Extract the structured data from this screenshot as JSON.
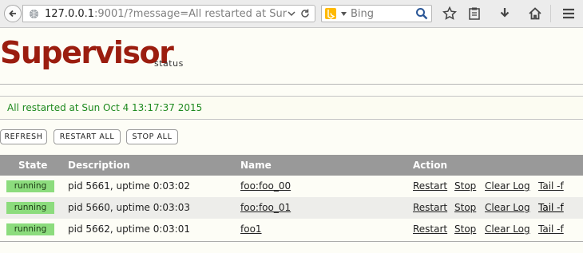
{
  "browser": {
    "url_host": "127.0.0.1",
    "url_rest": ":9001/?message=All restarted at Sur",
    "search_placeholder": "Bing",
    "icons": [
      "back-icon",
      "globe-icon",
      "dropdown-icon",
      "reload-icon",
      "bing-icon",
      "search-icon",
      "star-icon",
      "reading-list-icon",
      "download-icon",
      "home-icon",
      "menu-icon"
    ]
  },
  "header": {
    "logo": "Supervisor",
    "subtitle": "status"
  },
  "message": "All restarted at Sun Oct 4 13:17:37 2015",
  "buttons": {
    "refresh": "REFRESH",
    "restart_all": "RESTART ALL",
    "stop_all": "STOP ALL"
  },
  "table": {
    "columns": [
      "State",
      "Description",
      "Name",
      "Action"
    ],
    "rows": [
      {
        "state": "running",
        "description": "pid 5661, uptime 0:03:02",
        "name": "foo:foo_00",
        "actions": [
          "Restart",
          "Stop",
          "Clear Log",
          "Tail -f"
        ]
      },
      {
        "state": "running",
        "description": "pid 5660, uptime 0:03:03",
        "name": "foo:foo_01",
        "actions": [
          "Restart",
          "Stop",
          "Clear Log",
          "Tail -f"
        ]
      },
      {
        "state": "running",
        "description": "pid 5662, uptime 0:03:01",
        "name": "foo1",
        "actions": [
          "Restart",
          "Stop",
          "Clear Log",
          "Tail -f"
        ]
      }
    ]
  },
  "colors": {
    "brand": "#9b1d0f",
    "message": "#1f8a1f",
    "running": "#8cdc7d",
    "header_bg": "#999999"
  }
}
